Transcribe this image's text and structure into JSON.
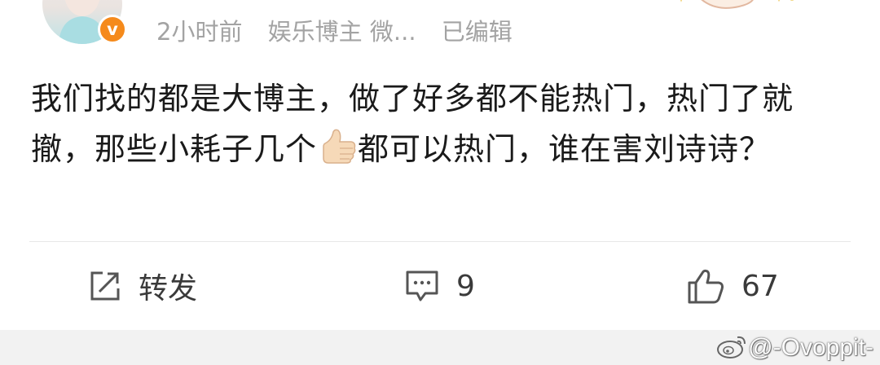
{
  "header": {
    "time": "2小时前",
    "tag": "娱乐博主 微...",
    "edited": "已编辑"
  },
  "post": {
    "text_before_emoji": "我们找的都是大博主，做了好多都不能热门，热门了就撤，那些小耗子几个",
    "emoji": "thumbs-up-emoji",
    "text_after_emoji": "都可以热门，谁在害刘诗诗？"
  },
  "actions": {
    "repost_label": "转发",
    "comment_count": "9",
    "like_count": "67"
  },
  "watermark": {
    "handle": "@-Ovoppit-"
  },
  "colors": {
    "badge": "#f58a1b",
    "meta_text": "#a3a3a3",
    "footer_bg": "#f2f2f2"
  }
}
